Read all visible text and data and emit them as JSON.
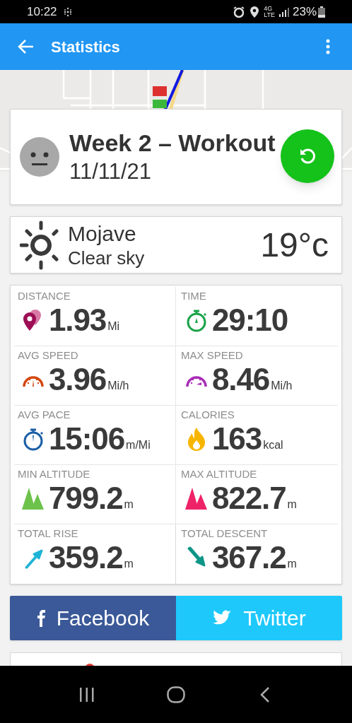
{
  "status_bar": {
    "time": "10:22",
    "network": "4G",
    "network_sub": "LTE",
    "battery": "23%"
  },
  "app_bar": {
    "title": "Statistics"
  },
  "workout": {
    "title": "Week 2 – Workout",
    "date": "11/11/21"
  },
  "weather": {
    "place": "Mojave",
    "condition": "Clear sky",
    "temperature": "19°c"
  },
  "stats": [
    {
      "kind": "distance",
      "label": "DISTANCE",
      "value": "1.93",
      "unit": "Mi"
    },
    {
      "kind": "time",
      "label": "TIME",
      "value": "29:10"
    },
    {
      "kind": "avg-speed",
      "label": "AVG SPEED",
      "value": "3.96",
      "unit": "Mi/h"
    },
    {
      "kind": "max-speed",
      "label": "MAX SPEED",
      "value": "8.46",
      "unit": "Mi/h"
    },
    {
      "kind": "pace",
      "label": "AVG PACE",
      "value": "15:06",
      "unit": "m/Mi"
    },
    {
      "kind": "calories",
      "label": "CALORIES",
      "value": "163",
      "unit": "kcal"
    },
    {
      "kind": "min-altitude",
      "label": "MIN ALTITUDE",
      "value": "799.2",
      "unit": "m"
    },
    {
      "kind": "max-altitude",
      "label": "MAX ALTITUDE",
      "value": "822.7",
      "unit": "m"
    },
    {
      "kind": "rise",
      "label": "TOTAL RISE",
      "value": "359.2",
      "unit": "m"
    },
    {
      "kind": "descent",
      "label": "TOTAL DESCENT",
      "value": "367.2",
      "unit": "m"
    }
  ],
  "share_buttons": [
    {
      "kind": "facebook",
      "label": "Facebook"
    },
    {
      "kind": "twitter",
      "label": "Twitter"
    }
  ]
}
